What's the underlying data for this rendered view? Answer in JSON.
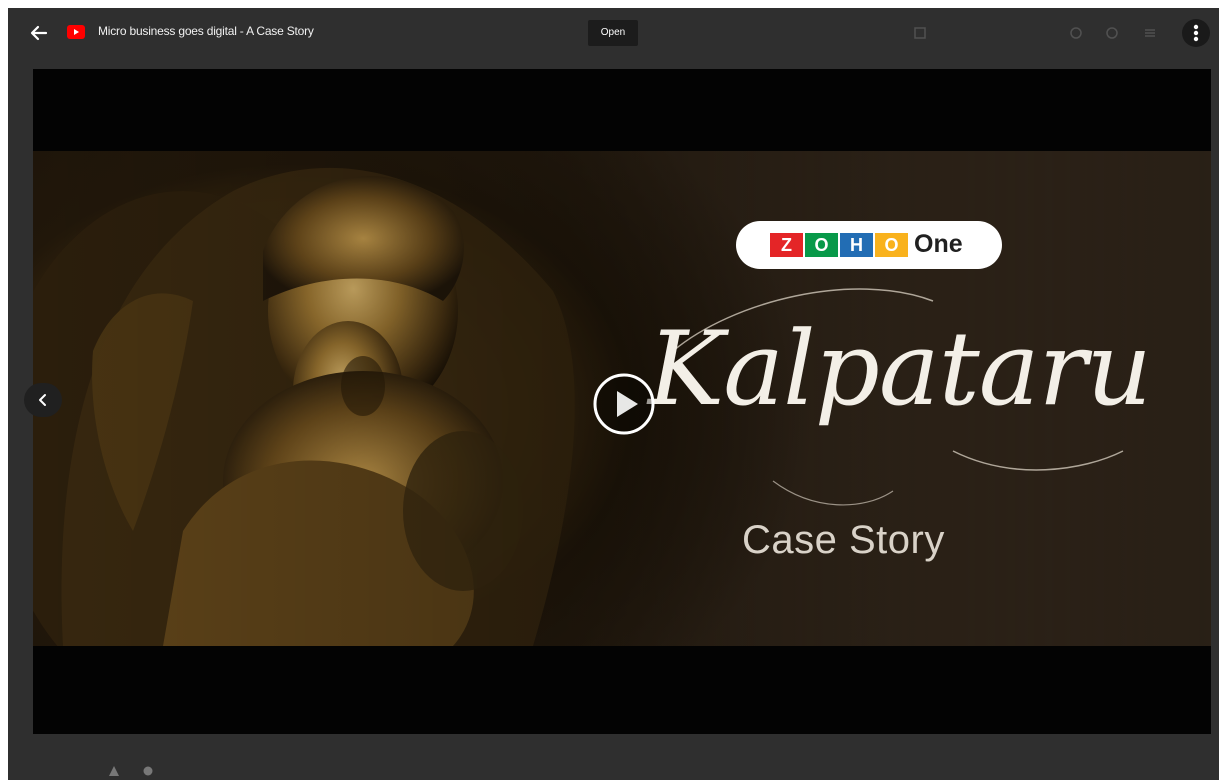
{
  "header": {
    "title": "Micro business goes digital - A Case Story",
    "open_label": "Open",
    "icons": [
      "back-arrow-icon",
      "youtube-icon",
      "more-vertical-icon"
    ]
  },
  "video": {
    "brand_letters": [
      "Z",
      "O",
      "H",
      "O"
    ],
    "brand_colors": [
      "#e42527",
      "#089949",
      "#226db4",
      "#f9b21d"
    ],
    "brand_suffix": "One",
    "headline": "Kalpataru",
    "subheadline": "Case Story",
    "controls": [
      "play-icon",
      "previous-icon"
    ]
  },
  "colors": {
    "viewer_background": "#2f2f2f",
    "video_background": "#030303",
    "title_text": "#f1f1f1"
  }
}
